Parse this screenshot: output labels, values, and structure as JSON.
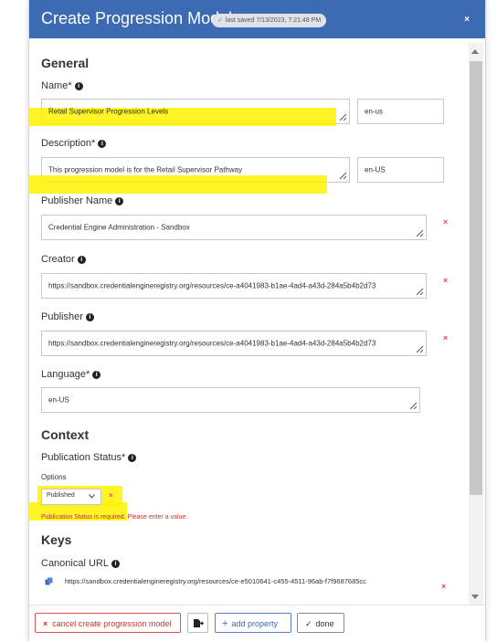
{
  "modal": {
    "title": "Create Progression Model",
    "saved_label": "last saved 7/13/2023, 7:21:48 PM",
    "close_label": "×"
  },
  "general": {
    "heading": "General",
    "name_label": "Name*",
    "name_value": "Retail Supervisor Progression Levels",
    "name_lang": "en-us",
    "description_label": "Description*",
    "description_value": "This progression model is for the Retail Supervisor Pathway",
    "description_lang": "en-US",
    "publisher_name_label": "Publisher Name",
    "publisher_name_value": "Credential Engine Administration - Sandbox",
    "creator_label": "Creator",
    "creator_value": "https://sandbox.credentialengineregistry.org/resources/ce-a4041983-b1ae-4ad4-a43d-284a5b4b2d73",
    "publisher_label": "Publisher",
    "publisher_value": "https://sandbox.credentialengineregistry.org/resources/ce-a4041983-b1ae-4ad4-a43d-284a5b4b2d73",
    "language_label": "Language*",
    "language_value": "en-US",
    "remove_symbol": "×"
  },
  "context": {
    "heading": "Context",
    "publication_status_label": "Publication Status*",
    "options_label": "Options",
    "status_selected": "Published",
    "error": "Publication Status is required. Please enter a value."
  },
  "keys": {
    "heading": "Keys",
    "canonical_label": "Canonical URL",
    "canonical_value": "https://sandbox.credentialengineregistry.org/resources/ce-e5010641-c455-4511-96ab-f7f9687685cc"
  },
  "footer": {
    "cancel_label": "cancel create progression model",
    "add_label": "add property",
    "done_label": "done"
  },
  "colors": {
    "header": "#3d6bb3",
    "highlight": "#fff200",
    "danger": "#d9534f"
  },
  "icons": [
    "check-icon",
    "close-icon",
    "info-icon",
    "resize-grip-icon",
    "chevron-down-icon",
    "copy-icon",
    "export-icon",
    "plus-icon"
  ]
}
